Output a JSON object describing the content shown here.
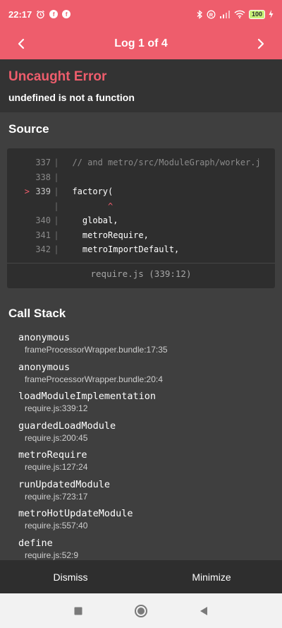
{
  "status_bar": {
    "time": "22:17",
    "battery": "100",
    "icons": [
      "alarm-icon",
      "f-badge-icon",
      "f-badge-icon",
      "bluetooth-icon",
      "registered-icon",
      "signal-icon",
      "wifi-icon",
      "battery-icon",
      "charging-icon"
    ]
  },
  "nav": {
    "title": "Log 1 of 4"
  },
  "error": {
    "title": "Uncaught Error",
    "message": "undefined is not a function"
  },
  "source": {
    "heading": "Source",
    "lines": [
      {
        "marker": "",
        "num": "337",
        "pipe": "|",
        "text": "  // and metro/src/ModuleGraph/worker.j",
        "comment": true
      },
      {
        "marker": "",
        "num": "338",
        "pipe": "|",
        "text": "",
        "comment": false
      },
      {
        "marker": ">",
        "num": "339",
        "pipe": "|",
        "text": "  factory(",
        "comment": false
      },
      {
        "marker": "",
        "num": "",
        "pipe": "|",
        "text": "         ^",
        "comment": false,
        "caret": true
      },
      {
        "marker": "",
        "num": "340",
        "pipe": "|",
        "text": "    global,",
        "comment": false
      },
      {
        "marker": "",
        "num": "341",
        "pipe": "|",
        "text": "    metroRequire,",
        "comment": false
      },
      {
        "marker": "",
        "num": "342",
        "pipe": "|",
        "text": "    metroImportDefault,",
        "comment": false
      }
    ],
    "location": "require.js (339:12)"
  },
  "call_stack": {
    "heading": "Call Stack",
    "frames": [
      {
        "name": "anonymous",
        "location": "frameProcessorWrapper.bundle:17:35"
      },
      {
        "name": "anonymous",
        "location": "frameProcessorWrapper.bundle:20:4"
      },
      {
        "name": "loadModuleImplementation",
        "location": "require.js:339:12"
      },
      {
        "name": "guardedLoadModule",
        "location": "require.js:200:45"
      },
      {
        "name": "metroRequire",
        "location": "require.js:127:24"
      },
      {
        "name": "runUpdatedModule",
        "location": "require.js:723:17"
      },
      {
        "name": "metroHotUpdateModule",
        "location": "require.js:557:40"
      },
      {
        "name": "define",
        "location": "require.js:52:9"
      }
    ]
  },
  "bottom": {
    "dismiss": "Dismiss",
    "minimize": "Minimize"
  },
  "colors": {
    "accent": "#ee5d6c",
    "background": "#3f3f3f",
    "panel": "#333333",
    "code_bg": "#2e2e2e"
  }
}
